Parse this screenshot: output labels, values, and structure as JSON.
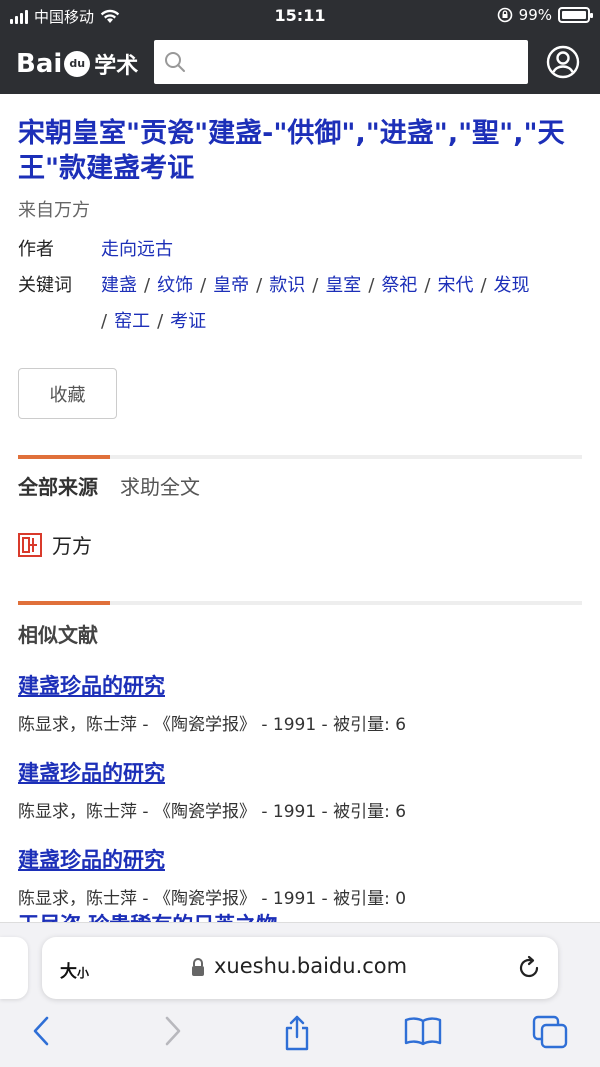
{
  "status": {
    "carrier": "中国移动",
    "time": "15:11",
    "battery": "99%",
    "battery_level": 0.99
  },
  "header": {
    "logo_text": "Bai",
    "logo_paw": "du",
    "logo_suffix": "学术",
    "search_value": ""
  },
  "paper": {
    "title": "宋朝皇室\"贡瓷\"建盏-\"供御\",\"进盏\",\"聖\",\"天王\"款建盏考证",
    "source": "来自万方",
    "author_label": "作者",
    "author": "走向远古",
    "keywords_label": "关键词",
    "keywords_line1": [
      "建盏",
      "纹饰",
      "皇帝",
      "款识",
      "皇室",
      "祭祀",
      "宋代",
      "发现"
    ],
    "keywords_line2": [
      "窑工",
      "考证"
    ],
    "collect_label": "收藏"
  },
  "sources": {
    "tab_all": "全部来源",
    "tab_help": "求助全文",
    "item": "万方"
  },
  "similar": {
    "heading": "相似文献",
    "docs": [
      {
        "title": "建盏珍品的研究",
        "meta": "陈显求，陈士萍 - 《陶瓷学报》 - 1991 - 被引量: 6"
      },
      {
        "title": "建盏珍品的研究",
        "meta": "陈显求，陈士萍 - 《陶瓷学报》 - 1991 - 被引量: 6"
      },
      {
        "title": "建盏珍品的研究",
        "meta": "陈显求，陈士萍 - 《陶瓷学报》 - 1991 - 被引量: 0"
      }
    ],
    "cut_title": "玉尽盗 珍贵稀有的日英之物"
  },
  "browser": {
    "aa_big": "大",
    "aa_small": "小",
    "url": "xueshu.baidu.com"
  },
  "colors": {
    "header_bg": "#2d2f33",
    "link": "#1c2fb8",
    "accent": "#e0703a"
  }
}
